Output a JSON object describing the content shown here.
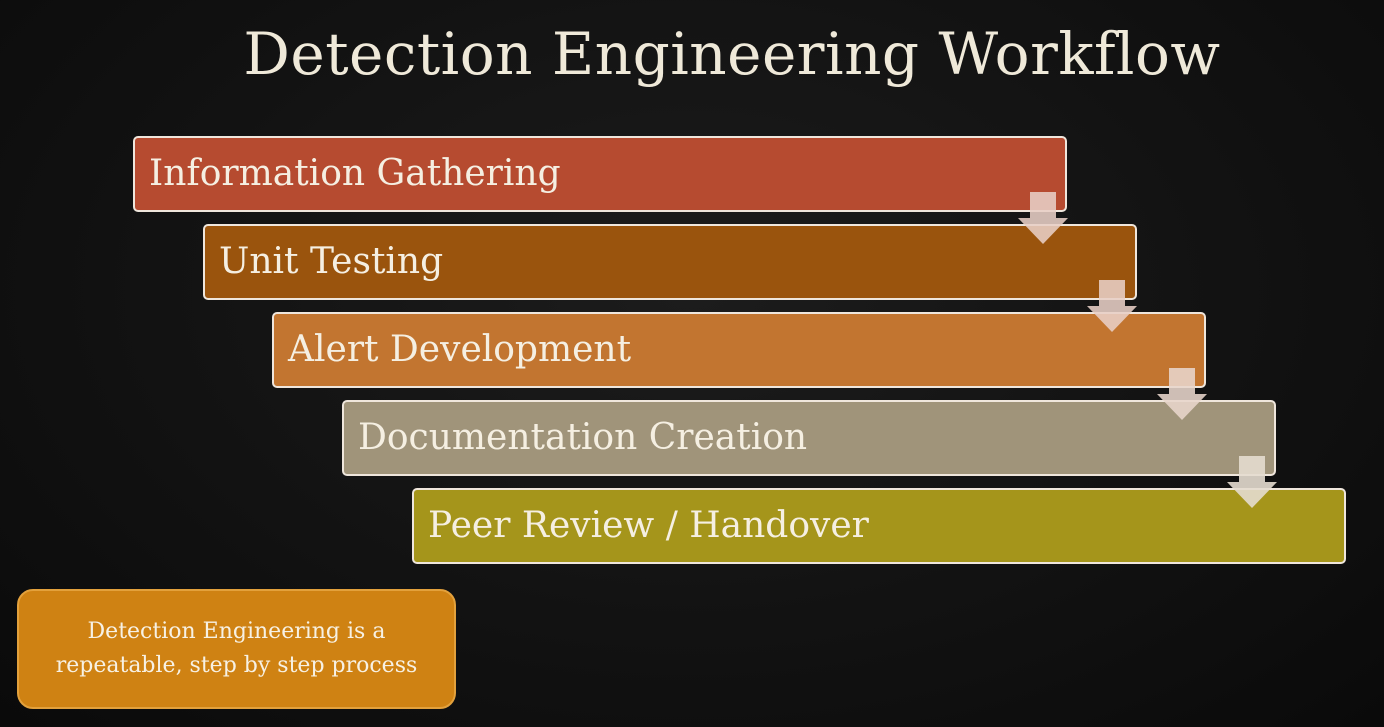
{
  "slide": {
    "title": "Detection Engineering Workflow"
  },
  "steps": [
    {
      "label": "Information Gathering",
      "color": "#b64b30"
    },
    {
      "label": "Unit Testing",
      "color": "#9a540d"
    },
    {
      "label": "Alert Development",
      "color": "#c27530"
    },
    {
      "label": "Documentation Creation",
      "color": "#a0947a"
    },
    {
      "label": "Peer Review / Handover",
      "color": "#a5951b"
    }
  ],
  "connectors": {
    "icon": "down-arrow-icon",
    "color": "#e8cfc6"
  },
  "note": {
    "text": "Detection Engineering is a repeatable, step by step process",
    "color": "#cf8213"
  }
}
